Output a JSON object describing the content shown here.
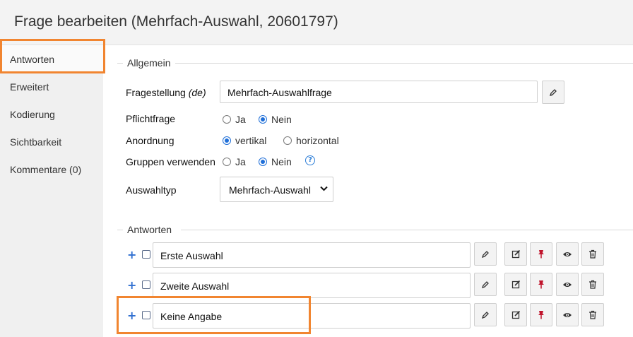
{
  "header": {
    "title": "Frage bearbeiten (Mehrfach-Auswahl, 20601797)"
  },
  "sidebar": {
    "items": [
      {
        "label": "Antworten",
        "active": true
      },
      {
        "label": "Erweitert"
      },
      {
        "label": "Kodierung"
      },
      {
        "label": "Sichtbarkeit"
      },
      {
        "label": "Kommentare (0)"
      }
    ]
  },
  "general": {
    "legend": "Allgemein",
    "question_label": "Fragestellung",
    "question_lang": "(de)",
    "question_value": "Mehrfach-Auswahlfrage",
    "required_label": "Pflichtfrage",
    "required_options": [
      "Ja",
      "Nein"
    ],
    "required_selected": "Nein",
    "layout_label": "Anordnung",
    "layout_options": [
      "vertikal",
      "horizontal"
    ],
    "layout_selected": "vertikal",
    "groups_label": "Gruppen verwenden",
    "groups_options": [
      "Ja",
      "Nein"
    ],
    "groups_selected": "Nein",
    "help_glyph": "?",
    "type_label": "Auswahltyp",
    "type_value": "Mehrfach-Auswahl"
  },
  "answers": {
    "legend": "Antworten",
    "plus_glyph": "+",
    "items": [
      {
        "value": "Erste Auswahl"
      },
      {
        "value": "Zweite Auswahl"
      },
      {
        "value": "Keine Angabe"
      }
    ]
  },
  "colors": {
    "highlight": "#f18530",
    "accent": "#1f6fd8",
    "pin": "#c0142c"
  },
  "icons": [
    "pencil-icon",
    "edit-icon",
    "pin-icon",
    "eye-icon",
    "trash-icon",
    "help-icon",
    "chevron-down-icon",
    "plus-icon"
  ]
}
